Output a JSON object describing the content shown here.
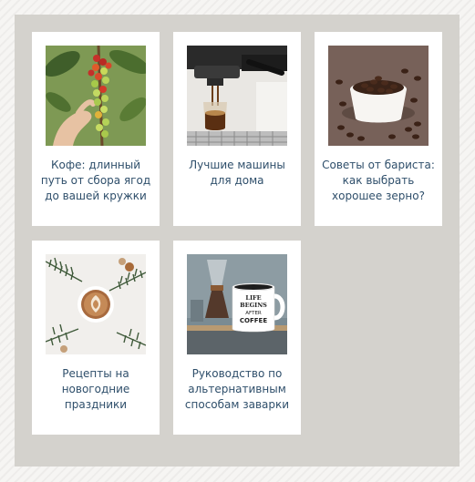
{
  "cards": [
    {
      "title": "Кофе: длинный\nпуть от сбора ягод\nдо вашей кружки",
      "image": "coffee-cherries-on-branch"
    },
    {
      "title": "Лучшие машины\nдля дома",
      "image": "espresso-machine-pouring"
    },
    {
      "title": "Советы от бариста:\nкак выбрать\nхорошее зерно?",
      "image": "cup-of-coffee-beans"
    },
    {
      "title": "Рецепты на\nновогодние\nпраздники",
      "image": "latte-with-fir-branches"
    },
    {
      "title": "Руководство по\nальтернативным\nспособам заварки",
      "image": "chemex-and-enamel-mug"
    }
  ],
  "mug_text": [
    "LIFE",
    "BEGINS",
    "AFTER",
    "COFFEE"
  ]
}
